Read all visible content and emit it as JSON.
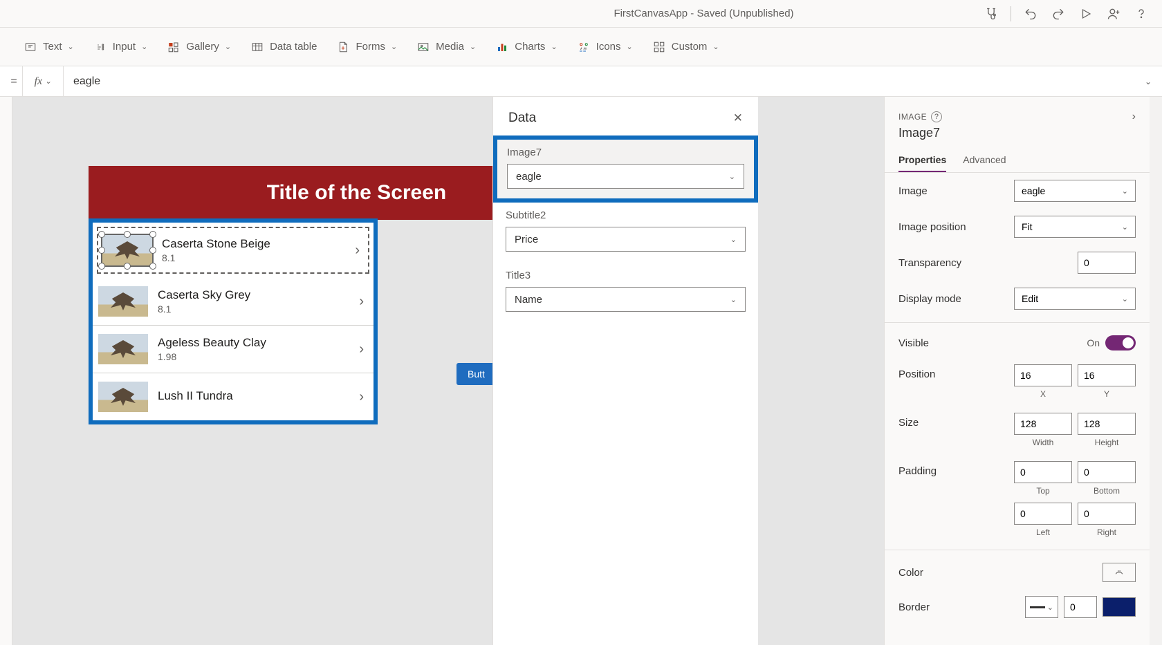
{
  "titlebar": {
    "appTitle": "FirstCanvasApp - Saved (Unpublished)"
  },
  "toolbar": {
    "items": [
      "Text",
      "Input",
      "Gallery",
      "Data table",
      "Forms",
      "Media",
      "Charts",
      "Icons",
      "Custom"
    ]
  },
  "formula": {
    "eq": "=",
    "fx": "fx",
    "value": "eagle"
  },
  "canvas": {
    "screenTitle": "Title of the Screen",
    "button": "Butt",
    "gallery": [
      {
        "name": "Caserta Stone Beige",
        "sub": "8.1"
      },
      {
        "name": "Caserta Sky Grey",
        "sub": "8.1"
      },
      {
        "name": "Ageless Beauty Clay",
        "sub": "1.98"
      },
      {
        "name": "Lush II Tundra",
        "sub": ""
      }
    ]
  },
  "dataPanel": {
    "title": "Data",
    "fields": [
      {
        "label": "Image7",
        "value": "eagle"
      },
      {
        "label": "Subtitle2",
        "value": "Price"
      },
      {
        "label": "Title3",
        "value": "Name"
      }
    ]
  },
  "props": {
    "type": "IMAGE",
    "name": "Image7",
    "tabs": {
      "properties": "Properties",
      "advanced": "Advanced"
    },
    "image": {
      "label": "Image",
      "value": "eagle"
    },
    "imagePosition": {
      "label": "Image position",
      "value": "Fit"
    },
    "transparency": {
      "label": "Transparency",
      "value": "0"
    },
    "displayMode": {
      "label": "Display mode",
      "value": "Edit"
    },
    "visible": {
      "label": "Visible",
      "value": "On"
    },
    "position": {
      "label": "Position",
      "x": "16",
      "y": "16",
      "xlabel": "X",
      "ylabel": "Y"
    },
    "size": {
      "label": "Size",
      "w": "128",
      "h": "128",
      "wlabel": "Width",
      "hlabel": "Height"
    },
    "padding": {
      "label": "Padding",
      "top": "0",
      "bottom": "0",
      "left": "0",
      "right": "0",
      "tlabel": "Top",
      "blabel": "Bottom",
      "llabel": "Left",
      "rlabel": "Right"
    },
    "color": {
      "label": "Color"
    },
    "border": {
      "label": "Border",
      "value": "0"
    }
  }
}
